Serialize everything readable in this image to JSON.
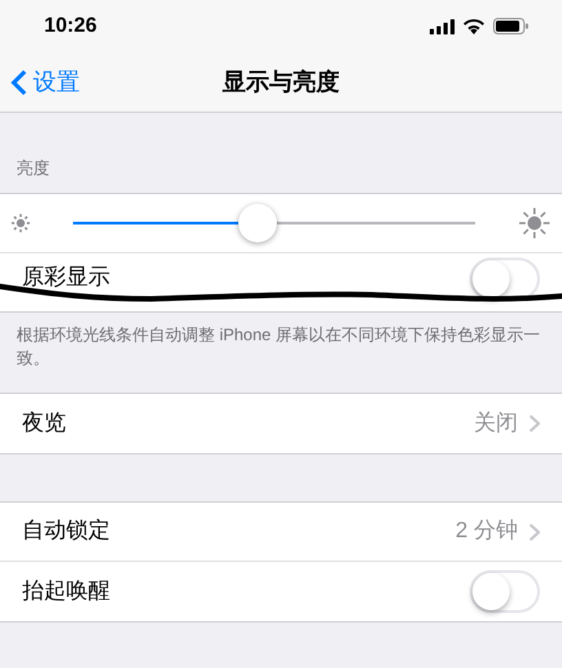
{
  "status_bar": {
    "time": "10:26"
  },
  "nav": {
    "back": "设置",
    "title": "显示与亮度"
  },
  "brightness": {
    "header": "亮度",
    "level": 0.46
  },
  "true_tone": {
    "label": "原彩显示",
    "on": false,
    "footer": "根据环境光线条件自动调整 iPhone 屏幕以在不同环境下保持色彩显示一致。"
  },
  "groups": [
    [
      {
        "kind": "link",
        "label": "夜览",
        "value": "关闭"
      }
    ],
    [
      {
        "kind": "link",
        "label": "自动锁定",
        "value": "2 分钟"
      },
      {
        "kind": "toggle",
        "label": "抬起唤醒",
        "on": false
      }
    ]
  ]
}
